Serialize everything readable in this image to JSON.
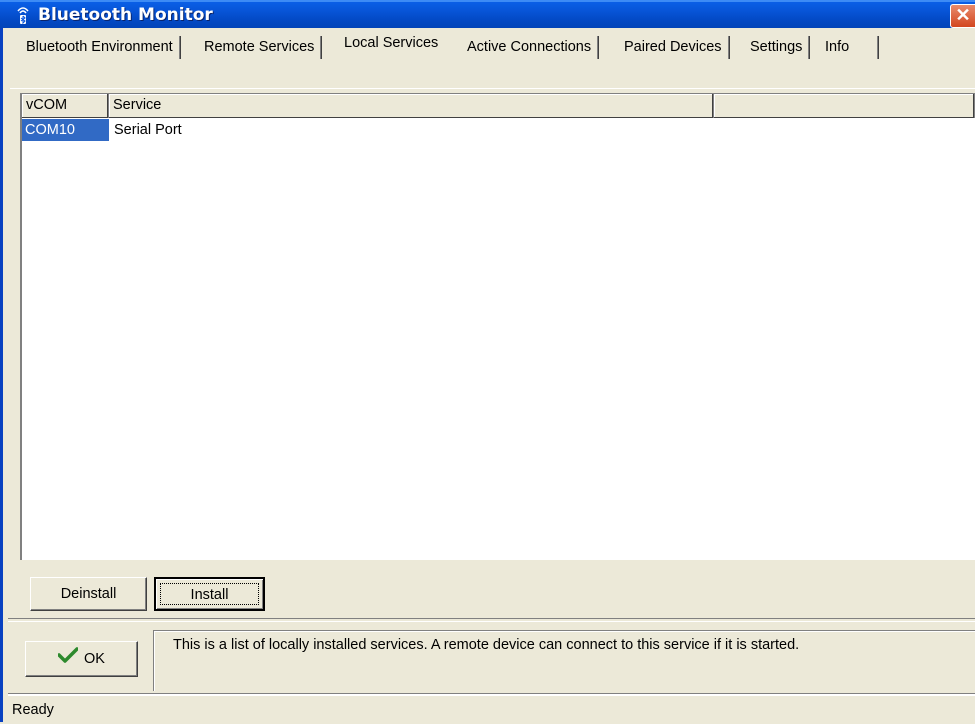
{
  "window": {
    "title": "Bluetooth Monitor",
    "close_label": "✕"
  },
  "tabs": [
    {
      "label": "Bluetooth Environment"
    },
    {
      "label": "Remote Services"
    },
    {
      "label": "Local Services"
    },
    {
      "label": "Active Connections"
    },
    {
      "label": "Paired Devices"
    },
    {
      "label": "Settings"
    },
    {
      "label": "Info"
    }
  ],
  "active_tab": "Local Services",
  "list": {
    "columns": [
      "vCOM",
      "Service"
    ],
    "rows": [
      {
        "vcom": "COM10",
        "service": "Serial Port",
        "selected": true
      }
    ]
  },
  "buttons": {
    "deinstall": "Deinstall",
    "install": "Install",
    "ok": "OK"
  },
  "info_text": "This is a list of locally installed services. A remote device can connect to this service if it is started.",
  "status": "Ready",
  "colors": {
    "title_bar": "#0855dd",
    "selection": "#316ac5",
    "ok_check": "#2d8a2d",
    "close": "#d3461f"
  },
  "icons": {
    "app": "bluetooth-antenna-icon",
    "ok": "checkmark-icon"
  }
}
